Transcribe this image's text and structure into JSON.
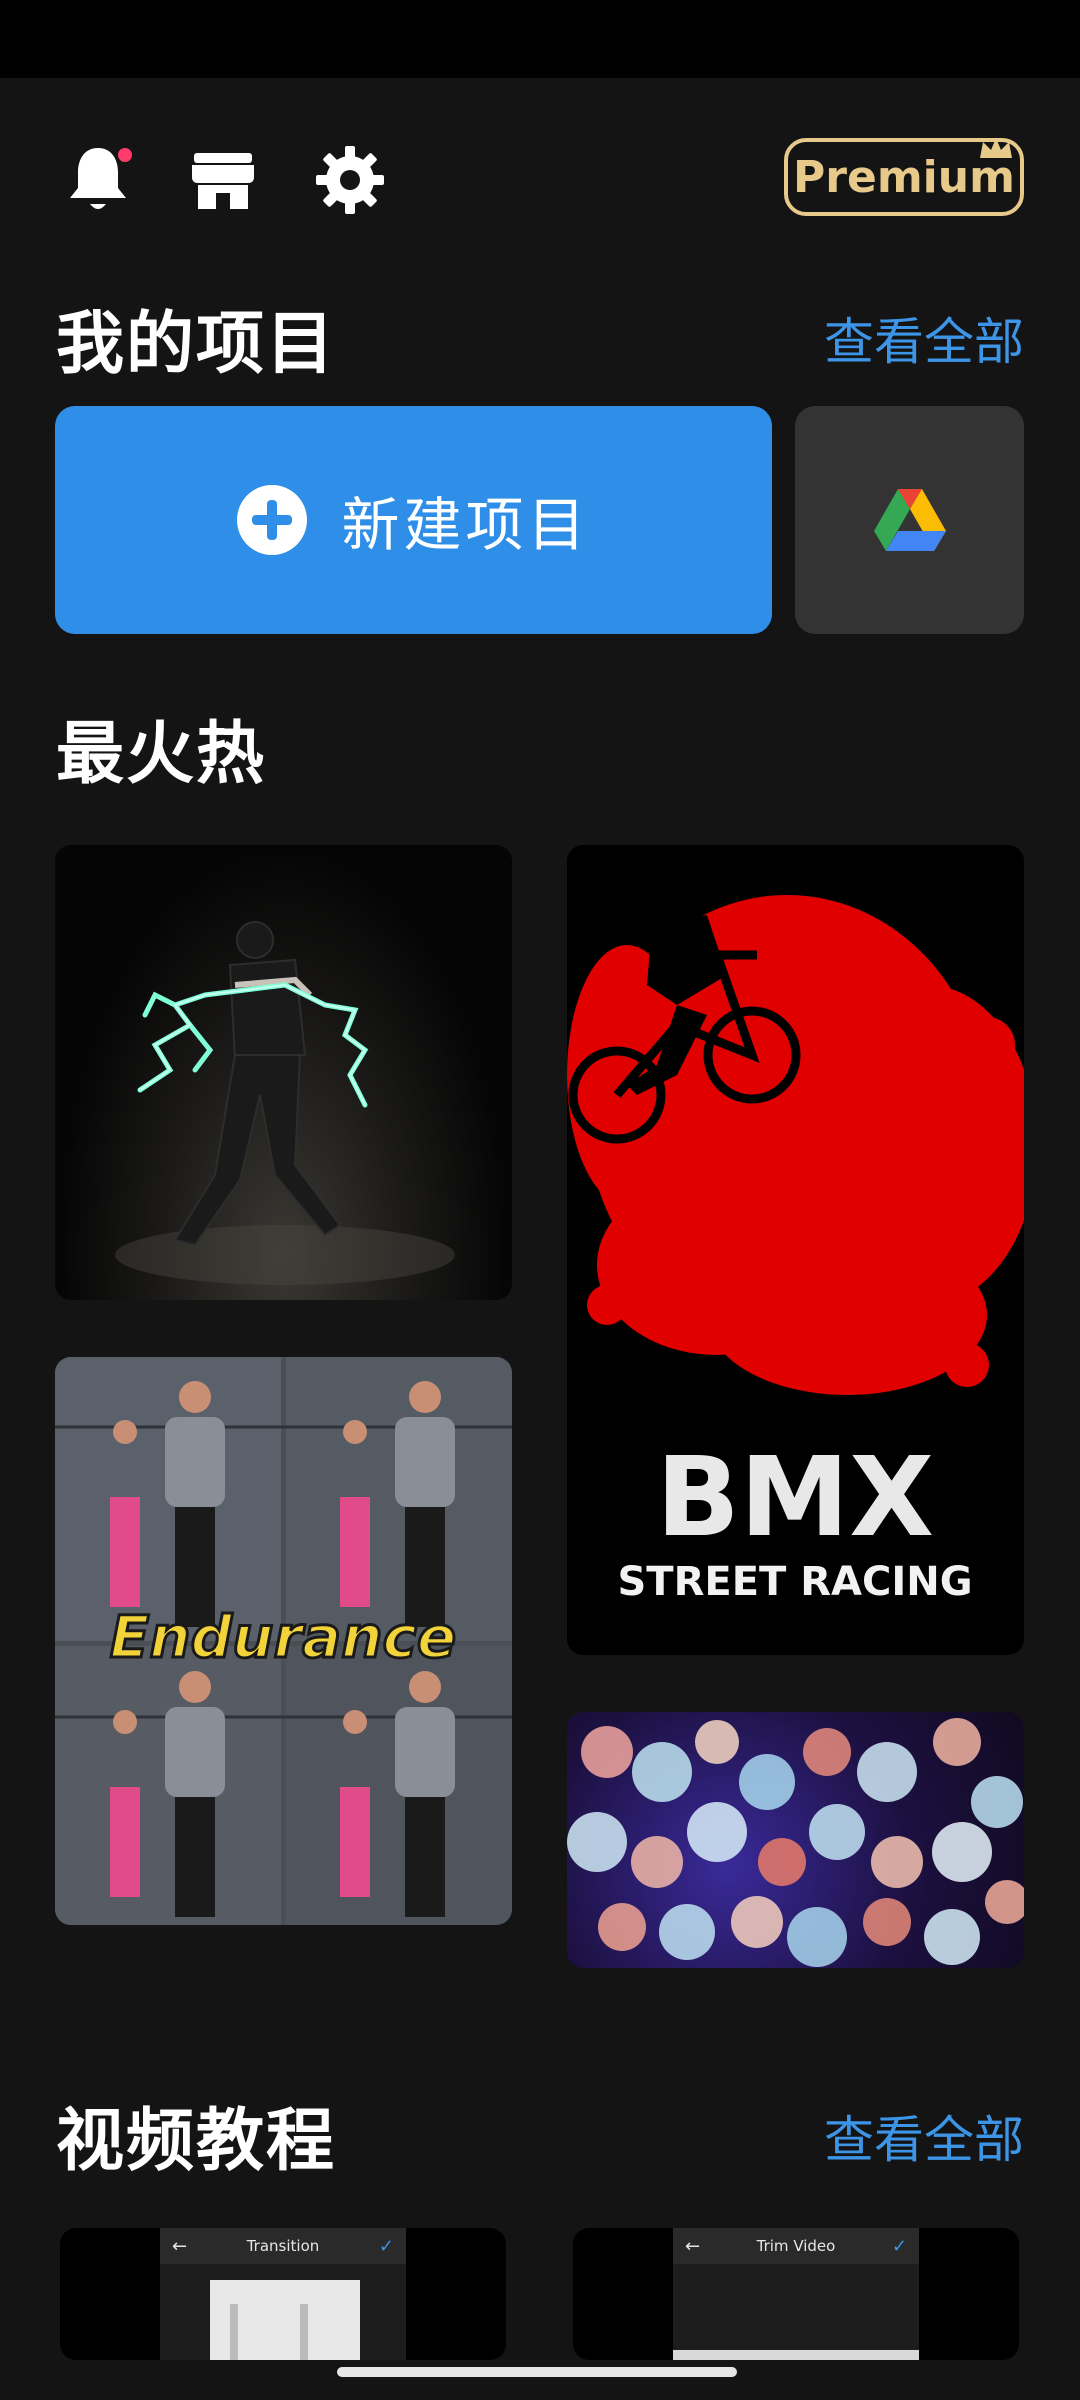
{
  "header": {
    "premium_label": "Premium",
    "icons": [
      "bell-icon",
      "store-icon",
      "gear-icon",
      "crown-icon"
    ],
    "accent_premium": "#e7c98a",
    "notification_dot_color": "#ff3b6b"
  },
  "projects": {
    "title": "我的项目",
    "view_all": "查看全部",
    "new_project_label": "新建项目",
    "accent": "#2f8fe8"
  },
  "hot": {
    "title": "最火热",
    "templates": [
      {
        "title_text": "",
        "theme": "dancer-lightning"
      },
      {
        "title_text": "BMX",
        "subtitle_text": "STREET RACING",
        "theme": "bmx-red-splash"
      },
      {
        "title_text": "Endurance",
        "theme": "runners-grid"
      },
      {
        "title_text": "",
        "theme": "bokeh-sparkle"
      }
    ]
  },
  "tutorials": {
    "title": "视频教程",
    "view_all": "查看全部",
    "items": [
      {
        "label": "Transition"
      },
      {
        "label": "Trim Video"
      }
    ]
  }
}
